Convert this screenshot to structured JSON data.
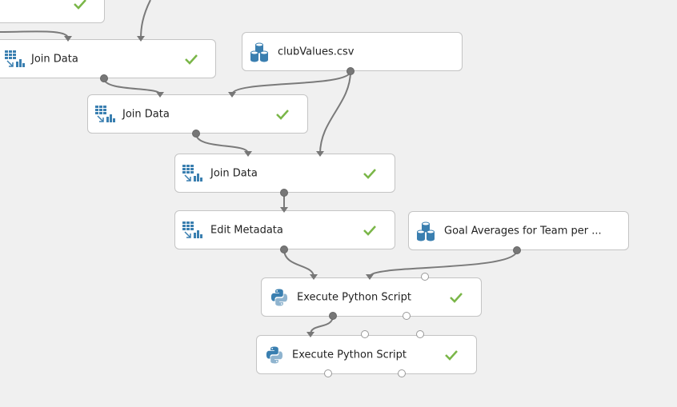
{
  "canvas": {
    "modules": [
      {
        "label": "",
        "icon": "table-transform-icon",
        "status": "success"
      },
      {
        "label": "Join Data",
        "icon": "table-transform-icon",
        "status": "success"
      },
      {
        "label": "clubValues.csv",
        "icon": "dataset-icon",
        "status": ""
      },
      {
        "label": "Join Data",
        "icon": "table-transform-icon",
        "status": "success"
      },
      {
        "label": "Join Data",
        "icon": "table-transform-icon",
        "status": "success"
      },
      {
        "label": "Edit Metadata",
        "icon": "table-transform-icon",
        "status": "success"
      },
      {
        "label": "Goal Averages for Team per ...",
        "icon": "dataset-icon",
        "status": ""
      },
      {
        "label": "Execute Python Script",
        "icon": "python-icon",
        "status": "success"
      },
      {
        "label": "Execute Python Script",
        "icon": "python-icon",
        "status": "success"
      }
    ]
  },
  "colors": {
    "canvas_bg": "#f0f0f0",
    "module_border": "#c4c4c4",
    "connector": "#7a7a7a",
    "check_green": "#7ab648",
    "icon_blue": "#3a7fb0"
  }
}
